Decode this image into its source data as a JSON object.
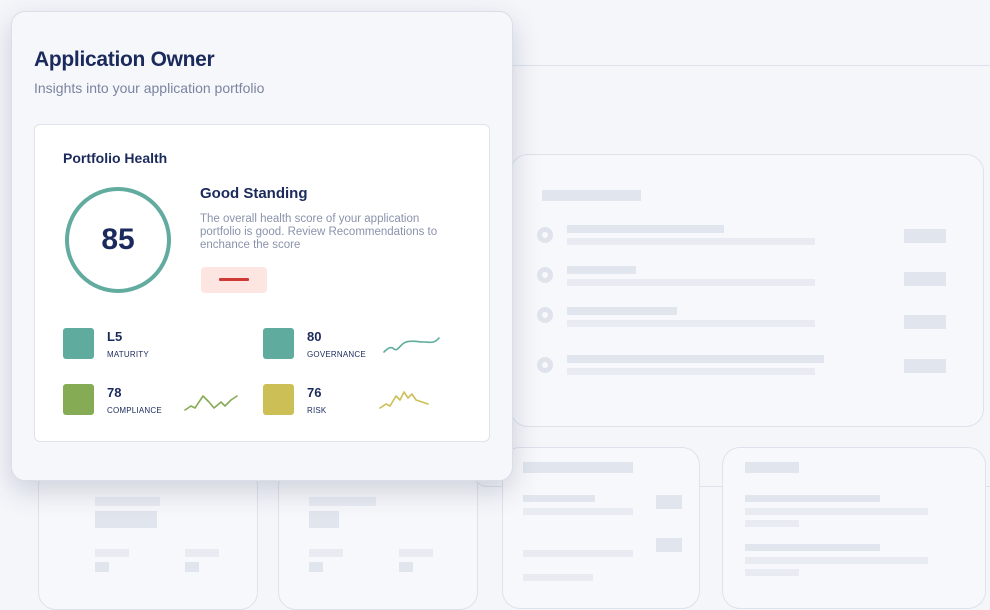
{
  "header": {
    "title": "Application Owner",
    "subtitle": "Insights into your application portfolio"
  },
  "portfolio": {
    "title": "Portfolio Health",
    "score": "85",
    "standing_title": "Good Standing",
    "standing_description": "The overall health score of your application portfolio is good. Review Recommendations to enchance the score"
  },
  "metrics": [
    {
      "value": "L5",
      "label": "MATURITY",
      "color": "#5fac9f"
    },
    {
      "value": "80",
      "label": "GOVERNANCE",
      "color": "#5fac9f",
      "spark_color": "#5fac9f"
    },
    {
      "value": "78",
      "label": "COMPLIANCE",
      "color": "#86ab55",
      "spark_color": "#86ab55"
    },
    {
      "value": "76",
      "label": "RISK",
      "color": "#ccbf55",
      "spark_color": "#ccbf55"
    }
  ],
  "colors": {
    "ring": "#62ab9f",
    "alert": "#cf3b34",
    "alert_bg": "#fde5e1",
    "heading": "#1b2a5c"
  }
}
